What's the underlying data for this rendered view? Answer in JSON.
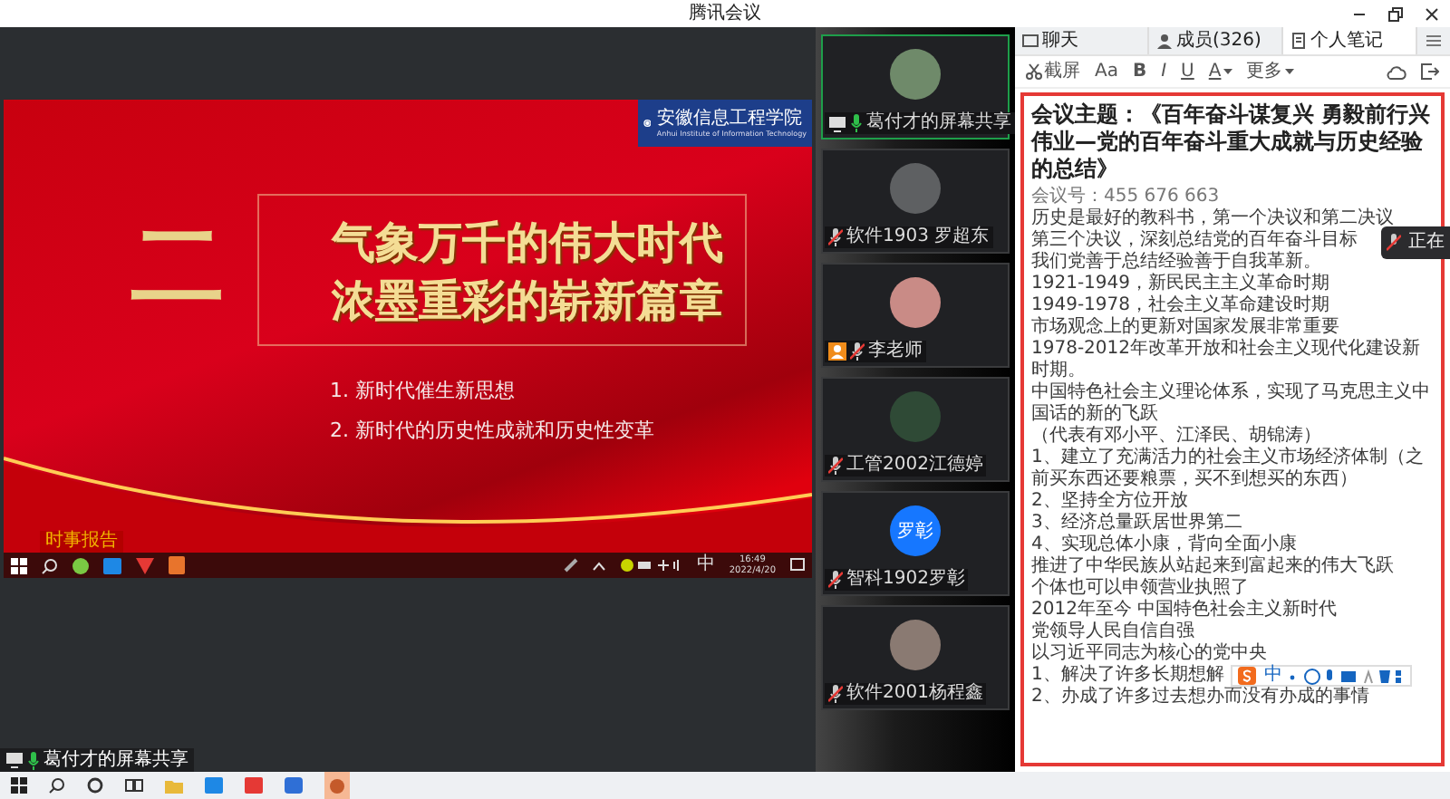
{
  "window": {
    "title": "腾讯会议"
  },
  "shared_screen": {
    "slide": {
      "logo_name": "安徽信息工程学院",
      "logo_subtitle": "Anhui Institute of Information Technology",
      "section_number": "二",
      "title_lines": [
        "气象万千的伟大时代",
        "浓墨重彩的崭新篇章"
      ],
      "points": [
        "1. 新时代催生新思想",
        "2. 新时代的历史性成就和历史性变革"
      ],
      "footer_logo": "时事报告"
    },
    "taskbar": {
      "ime": "中",
      "time": "16:49",
      "date": "2022/4/20"
    },
    "label": "葛付才的屏幕共享"
  },
  "participants": [
    {
      "name": "葛付才的屏幕共享",
      "sharing": true,
      "host": false,
      "mic_on": true,
      "selected": true
    },
    {
      "name": "软件1903 罗超东",
      "sharing": false,
      "host": false,
      "mic_on": false,
      "selected": false
    },
    {
      "name": "李老师",
      "sharing": false,
      "host": true,
      "mic_on": false,
      "selected": false
    },
    {
      "name": "工管2002江德婷",
      "sharing": false,
      "host": false,
      "mic_on": false,
      "selected": false
    },
    {
      "name": "智科1902罗彰",
      "initials": "罗彰",
      "sharing": false,
      "host": false,
      "mic_on": false,
      "selected": false
    },
    {
      "name": "软件2001杨程鑫",
      "sharing": false,
      "host": false,
      "mic_on": false,
      "selected": false
    }
  ],
  "notes_panel": {
    "tabs": [
      {
        "label": "聊天",
        "kind": "chat",
        "selected": false
      },
      {
        "label": "成员(326)",
        "kind": "members",
        "selected": false
      },
      {
        "label": "个人笔记",
        "kind": "notes",
        "selected": true
      }
    ],
    "toolbar": [
      {
        "label": "截屏",
        "kind": "screenshot"
      },
      {
        "label": "Aa",
        "kind": "size"
      },
      {
        "label": "B",
        "kind": "bold"
      },
      {
        "label": "I",
        "kind": "italic"
      },
      {
        "label": "U",
        "kind": "underline"
      },
      {
        "label": "A",
        "kind": "color"
      },
      {
        "label": "更多",
        "kind": "more"
      }
    ],
    "title": "会议主题：《百年奋斗谋复兴 勇毅前行兴伟业—党的百年奋斗重大成就与历史经验的总结》",
    "lines": [
      "会议号：455 676 663",
      "历史是最好的教科书，第一个决议和第二决议",
      "第三个决议，深刻总结党的百年奋斗目标",
      "我们党善于总结经验善于自我革新。",
      "1921-1949，新民民主主义革命时期",
      "1949-1978，社会主义革命建设时期",
      "市场观念上的更新对国家发展非常重要",
      "1978-2012年改革开放和社会主义现代化建设新时期。",
      "中国特色社会主义理论体系，实现了马克思主义中国话的新的飞跃",
      "（代表有邓小平、江泽民、胡锦涛）",
      "1、建立了充满活力的社会主义市场经济体制（之前买东西还要粮票，买不到想买的东西）",
      "2、坚持全方位开放",
      "3、经济总量跃居世界第二",
      "4、实现总体小康，背向全面小康",
      "推进了中华民族从站起来到富起来的伟大飞跃",
      "个体也可以申领营业执照了",
      "2012年至今 中国特色社会主义新时代",
      "党领导人民自信自强",
      "以习近平同志为核心的党中央",
      "1、解决了许多长期想解",
      "2、办成了许多过去想办而没有办成的事情"
    ]
  },
  "speaking_popup": {
    "label": "正在"
  },
  "ime_toolbar": {
    "label": "中"
  }
}
